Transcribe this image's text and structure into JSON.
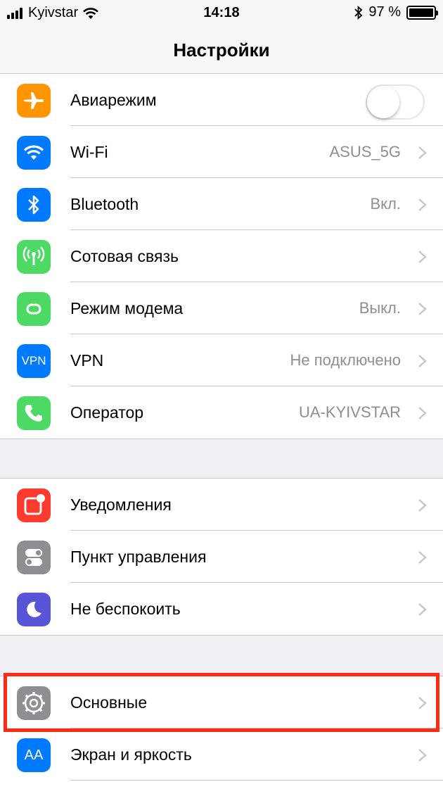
{
  "status_bar": {
    "carrier": "Kyivstar",
    "time": "14:18",
    "battery": "97 %"
  },
  "nav": {
    "title": "Настройки"
  },
  "groups": [
    {
      "items": [
        {
          "label": "Авиарежим",
          "icon": "airplane-icon",
          "color": "#ff9500",
          "toggle": true,
          "on": false
        },
        {
          "label": "Wi-Fi",
          "value": "ASUS_5G",
          "icon": "wifi-icon",
          "color": "#007aff"
        },
        {
          "label": "Bluetooth",
          "value": "Вкл.",
          "icon": "bluetooth-icon",
          "color": "#007aff"
        },
        {
          "label": "Сотовая связь",
          "value": "",
          "icon": "cellular-icon",
          "color": "#4cd964"
        },
        {
          "label": "Режим модема",
          "value": "Выкл.",
          "icon": "hotspot-icon",
          "color": "#4cd964"
        },
        {
          "label": "VPN",
          "value": "Не подключено",
          "icon": "vpn-icon",
          "icon_text": "VPN",
          "color": "#007aff"
        },
        {
          "label": "Оператор",
          "value": "UA-KYIVSTAR",
          "icon": "phone-icon",
          "color": "#4cd964"
        }
      ]
    },
    {
      "items": [
        {
          "label": "Уведомления",
          "icon": "notifications-icon",
          "color": "#ff3b30"
        },
        {
          "label": "Пункт управления",
          "icon": "control-center-icon",
          "color": "#8e8e93"
        },
        {
          "label": "Не беспокоить",
          "icon": "moon-icon",
          "color": "#5856d6"
        }
      ]
    },
    {
      "items": [
        {
          "label": "Основные",
          "icon": "gear-icon",
          "color": "#8e8e93",
          "highlighted": true
        },
        {
          "label": "Экран и яркость",
          "icon": "display-icon",
          "icon_text": "AA",
          "color": "#007aff"
        }
      ]
    }
  ],
  "colors": {
    "highlight": "#ff2a13",
    "value_text": "#8e8e93",
    "separator": "#c8c7cc"
  }
}
